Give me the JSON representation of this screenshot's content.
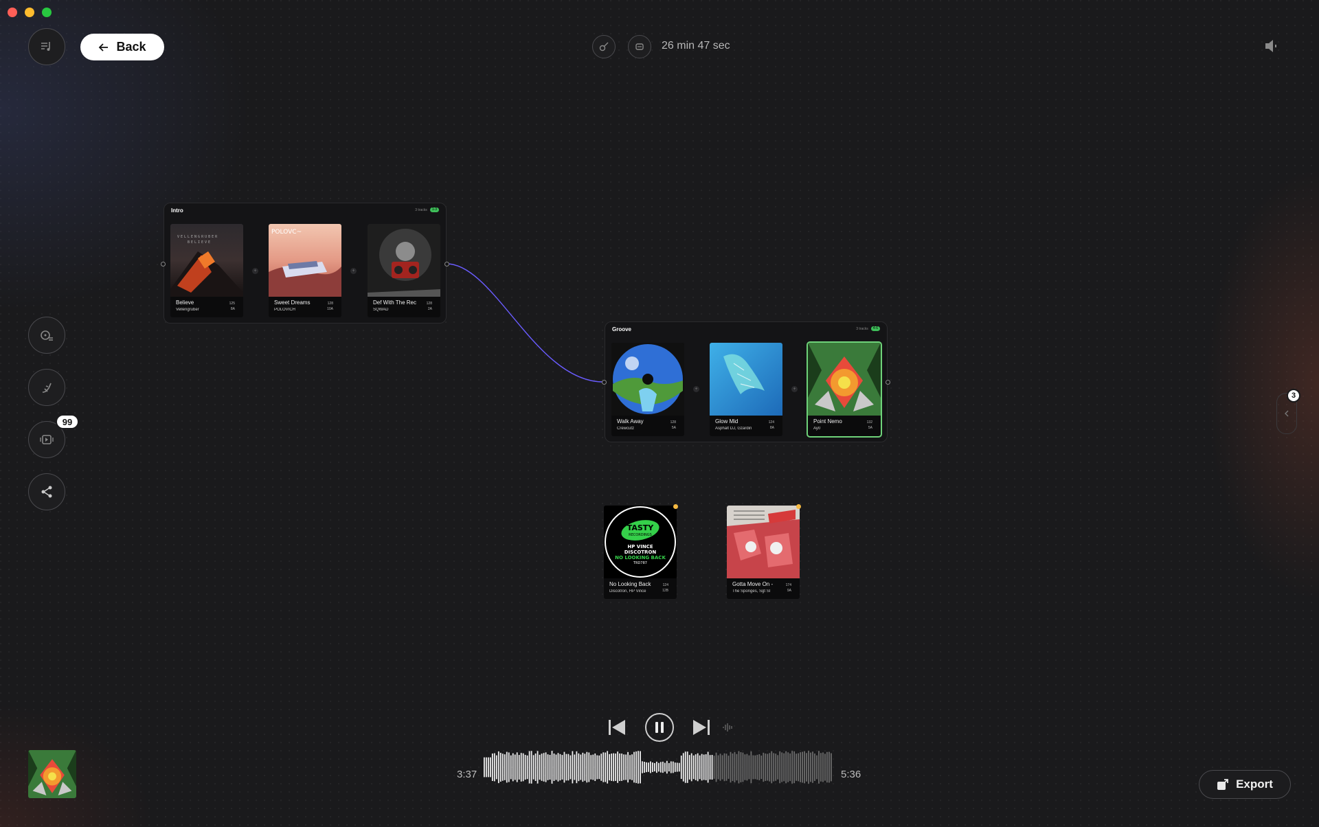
{
  "window": {
    "traffic_lights": [
      "#ff5f57",
      "#febc2e",
      "#28c840"
    ]
  },
  "header": {
    "back_label": "Back",
    "duration": "26 min 47 sec"
  },
  "sidebar": {
    "queue_badge": "99"
  },
  "groups": [
    {
      "title": "Intro",
      "meta": "3 tracks",
      "pill": "1-3",
      "tracks": [
        {
          "title": "Believe",
          "artist": "Vellengruber",
          "stat1": "125",
          "stat2": "8A"
        },
        {
          "title": "Sweet Dreams",
          "artist": "POLOVICH",
          "stat1": "128",
          "stat2": "10A"
        },
        {
          "title": "Def With The Rec",
          "artist": "SQWAD",
          "stat1": "128",
          "stat2": "2A"
        }
      ]
    },
    {
      "title": "Groove",
      "meta": "3 tracks",
      "pill": "4-6",
      "tracks": [
        {
          "title": "Walk Away",
          "artist": "Crewcutz",
          "stat1": "128",
          "stat2": "5A"
        },
        {
          "title": "Glow Mid",
          "artist": "Asphalt DJ, Gzardin",
          "stat1": "124",
          "stat2": "8A"
        },
        {
          "title": "Point Nemo",
          "artist": "Ay0",
          "stat1": "132",
          "stat2": "5A"
        }
      ]
    }
  ],
  "loose_tracks": [
    {
      "title": "No Looking Back",
      "artist": "Discotron, HP Vince",
      "stat1": "124",
      "stat2": "12B",
      "cover_text": [
        "TASTY",
        "RECORDINGS",
        "HP VINCE",
        "DISCOTRON",
        "NO LOOKING BACK",
        "TRD787"
      ]
    },
    {
      "title": "Gotta Move On -",
      "artist": "The Sponges, Sgt Sl",
      "stat1": "174",
      "stat2": "9A"
    }
  ],
  "right_panel_badge": "3",
  "player": {
    "elapsed": "3:37",
    "total": "5:36",
    "progress": 0.654
  },
  "export_label": "Export",
  "colors": {
    "accent_green": "#3fbf5a",
    "connector": "#6a5cff",
    "warning_dot": "#f5b942"
  }
}
